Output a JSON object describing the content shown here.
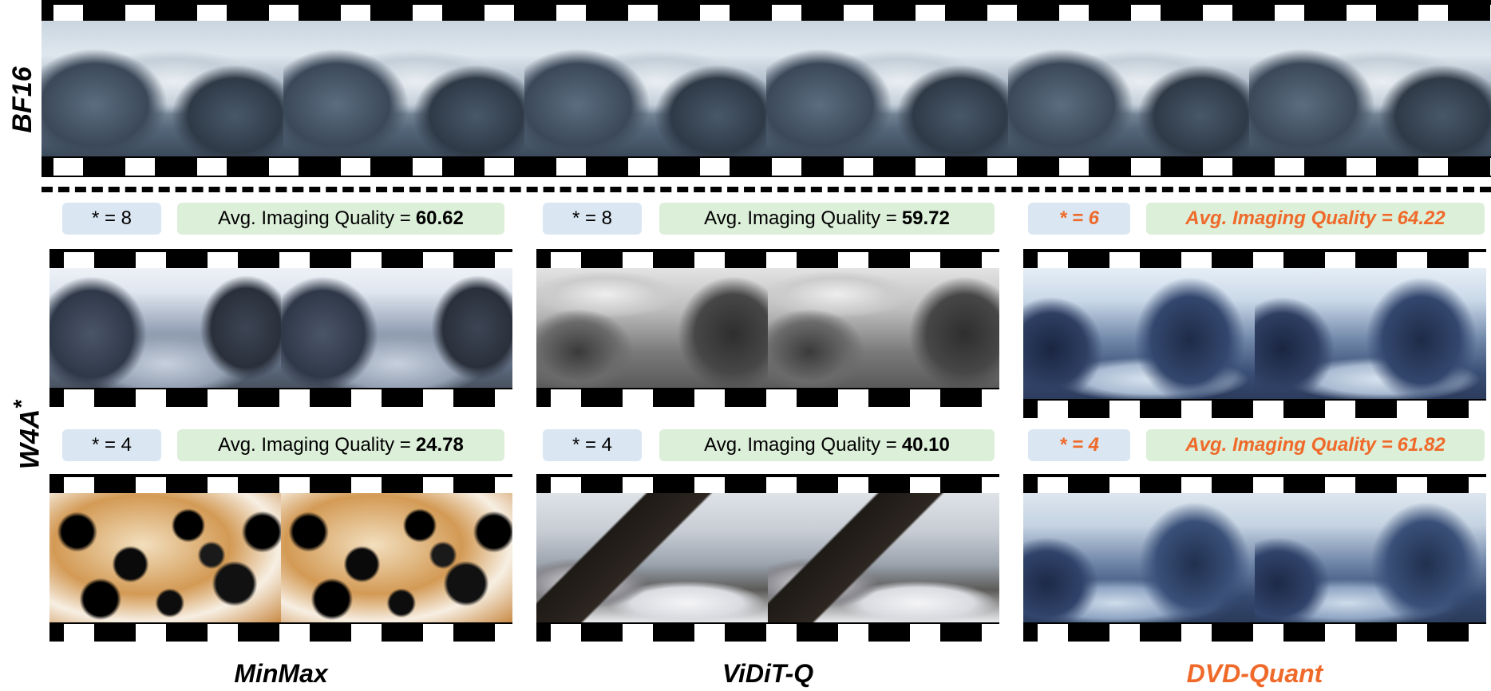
{
  "row_labels": {
    "reference": "BF16",
    "quantized_prefix": "W4A",
    "quantized_suffix": "*"
  },
  "methods": [
    {
      "name": "MinMax",
      "highlight": false,
      "rows": [
        {
          "bits_label": "* = 8",
          "quality_label": "Avg. Imaging Quality =",
          "quality_value": "60.62"
        },
        {
          "bits_label": "* = 4",
          "quality_label": "Avg. Imaging Quality =",
          "quality_value": "24.78"
        }
      ]
    },
    {
      "name": "ViDiT-Q",
      "highlight": false,
      "rows": [
        {
          "bits_label": "* = 8",
          "quality_label": "Avg. Imaging Quality =",
          "quality_value": "59.72"
        },
        {
          "bits_label": "* = 4",
          "quality_label": "Avg. Imaging Quality =",
          "quality_value": "40.10"
        }
      ]
    },
    {
      "name": "DVD-Quant",
      "highlight": true,
      "rows": [
        {
          "bits_label": "* = 6",
          "quality_label": "Avg. Imaging Quality =",
          "quality_value": "64.22"
        },
        {
          "bits_label": "* = 4",
          "quality_label": "Avg. Imaging Quality =",
          "quality_value": "61.82"
        }
      ]
    }
  ],
  "colors": {
    "highlight": "#ef6a2a",
    "bits_badge_bg": "#dae6f1",
    "quality_badge_bg": "#dcefd9",
    "film": "#000000"
  }
}
